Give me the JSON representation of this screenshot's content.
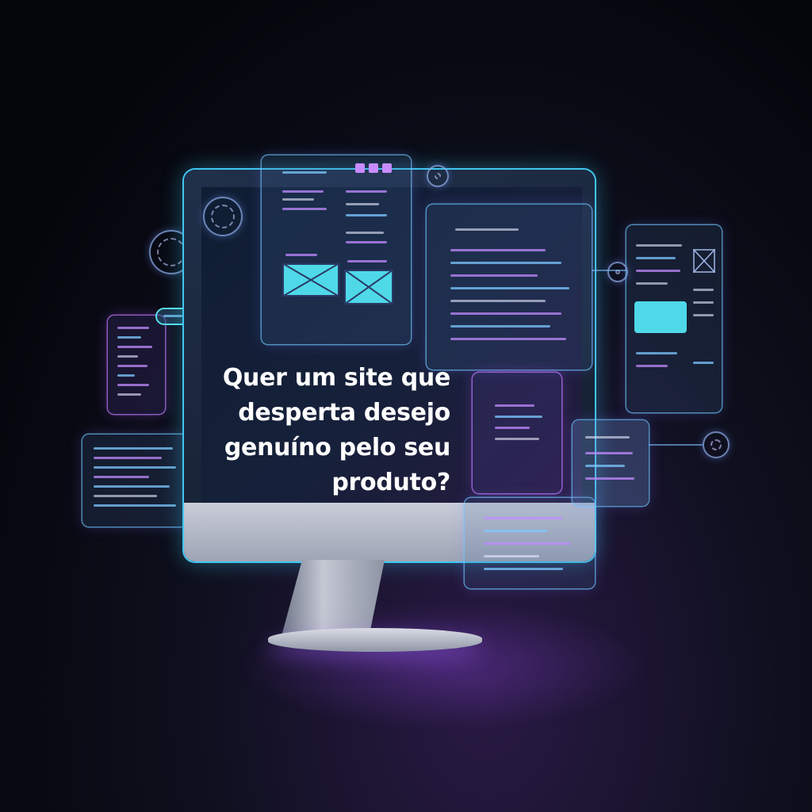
{
  "headline": {
    "line1": "Quer um site que",
    "line2": "desperta desejo",
    "line3": "genuíno pelo seu",
    "line4": "produto?"
  },
  "colors": {
    "accent_cyan": "#3fc7f0",
    "accent_purple": "#c18bff",
    "background": "#05060c",
    "text": "#ffffff"
  },
  "icons": [
    "monitor-icon",
    "wireframe-image-icon",
    "settings-ring-icon"
  ]
}
